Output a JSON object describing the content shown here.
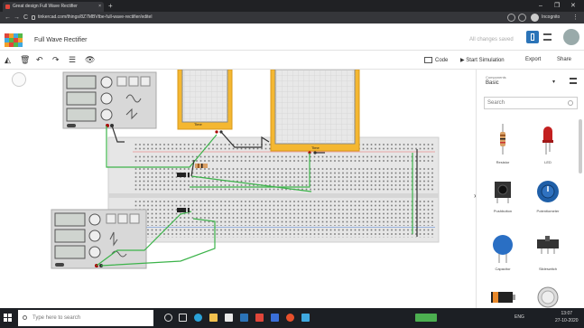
{
  "browser": {
    "tab_title": "Great design Full Wave Rectifier",
    "tab_close": "×",
    "new_tab": "+",
    "url": "tinkercad.com/things/8Z7MBVtbe-full-wave-rectifier/editel",
    "incognito_label": "Incognito",
    "window_buttons": [
      "–",
      "❐",
      "✕"
    ],
    "nav_buttons": [
      "←",
      "→",
      "C"
    ]
  },
  "app": {
    "project_title": "Full Wave Rectifier",
    "save_status": "All changes saved"
  },
  "toolbar": {
    "tools": [
      "◭",
      "🗑",
      "↶",
      "↷",
      "☰",
      "👁"
    ],
    "code_label": "Code",
    "start_simulation_label": "Start Simulation",
    "export_label": "Export",
    "share_label": "Share"
  },
  "canvas": {
    "scope1_label": "Time",
    "scope2_label": "Time"
  },
  "panel": {
    "components_label": "Components",
    "components_value": "Basic",
    "caret": "▾",
    "search_placeholder": "Search",
    "collapse_glyph": "›",
    "items": [
      {
        "label": "Resistor",
        "icon": "resistor-icon"
      },
      {
        "label": "LED",
        "icon": "led-icon"
      },
      {
        "label": "Pushbutton",
        "icon": "pushbutton-icon"
      },
      {
        "label": "Potentiometer",
        "icon": "potentiometer-icon"
      },
      {
        "label": "Capacitor",
        "icon": "capacitor-icon"
      },
      {
        "label": "Slideswitch",
        "icon": "slideswitch-icon"
      },
      {
        "label": "",
        "icon": "battery-icon"
      },
      {
        "label": "",
        "icon": "coin-cell-icon"
      }
    ]
  },
  "taskbar": {
    "search_placeholder": "Type here to search",
    "tray_text": "ENG",
    "time": "13:07",
    "date": "27-10-2020"
  },
  "colors": {
    "breadboard": "#e9e9e9",
    "wire_green": "#3cb34a",
    "wire_black": "#333333",
    "scope_frame": "#f4b731",
    "function_generator": "#d6d6d6",
    "app_accent": "#2b74b8"
  }
}
